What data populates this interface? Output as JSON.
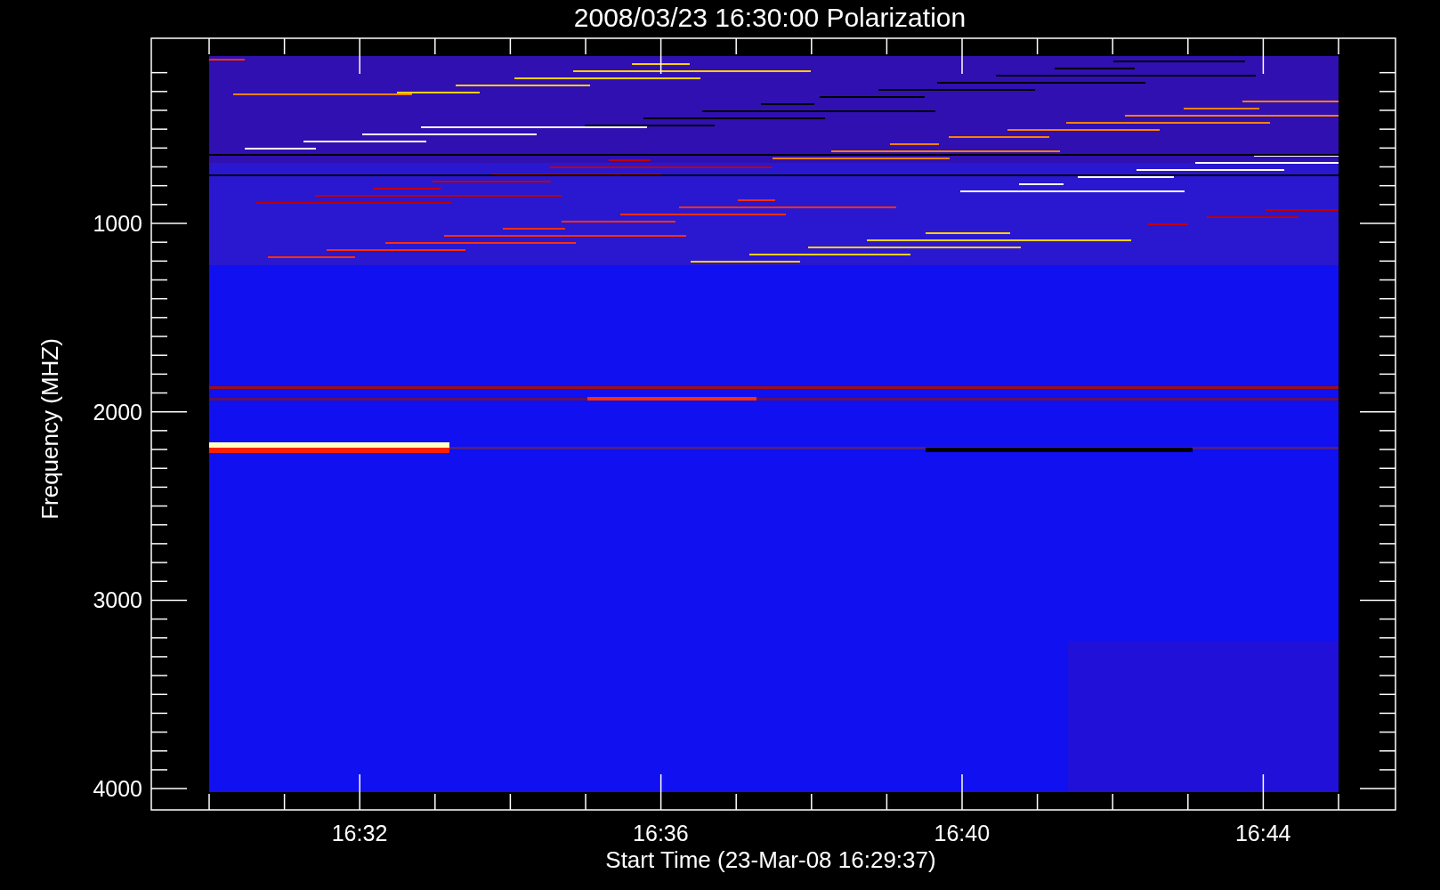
{
  "plot": {
    "title": "2008/03/23 16:30:00 Polarization",
    "ylabel": "Frequency (MHZ)",
    "xlabel": "Start Time (23-Mar-08 16:29:37)",
    "yticks": [
      "1000",
      "2000",
      "3000",
      "4000"
    ],
    "xticks": [
      "16:32",
      "16:36",
      "16:40",
      "16:44"
    ]
  }
}
